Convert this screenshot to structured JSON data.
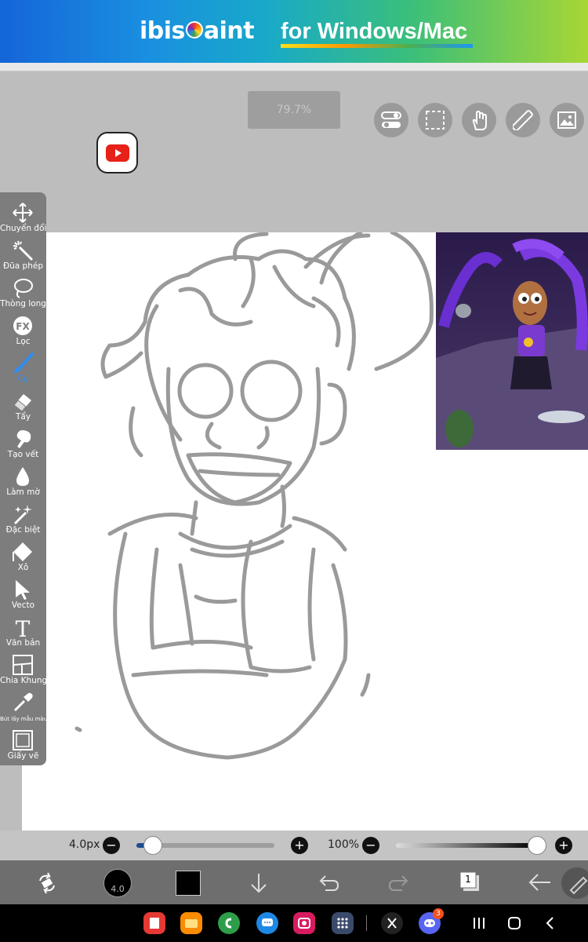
{
  "banner": {
    "brand_left": "ibis",
    "brand_right": "aint",
    "tagline": "for Windows/Mac"
  },
  "zoom_label": "79.7%",
  "top_buttons": [
    "toggle-icon",
    "selection-icon",
    "hand-icon",
    "ruler-icon",
    "image-icon"
  ],
  "toolbar": {
    "tools": [
      {
        "label": "Chuyển đổi",
        "icon": "move-icon"
      },
      {
        "label": "Đũa phép",
        "icon": "magic-wand-icon"
      },
      {
        "label": "Thòng long",
        "icon": "lasso-icon"
      },
      {
        "label": "Lọc",
        "icon": "fx-icon"
      },
      {
        "label": "Cọ",
        "icon": "brush-icon",
        "active": true
      },
      {
        "label": "Tẩy",
        "icon": "eraser-icon"
      },
      {
        "label": "Tạo vết",
        "icon": "smudge-icon"
      },
      {
        "label": "Làm mờ",
        "icon": "blur-icon"
      },
      {
        "label": "Đặc biệt",
        "icon": "special-icon"
      },
      {
        "label": "Xô",
        "icon": "bucket-icon"
      },
      {
        "label": "Vecto",
        "icon": "vector-icon"
      },
      {
        "label": "Văn bản",
        "icon": "text-icon"
      },
      {
        "label": "Chia Khung",
        "icon": "frame-divider-icon"
      },
      {
        "label": "Bút lấy mẫu màu",
        "icon": "eyedropper-icon"
      },
      {
        "label": "Giấy vẽ",
        "icon": "canvas-icon"
      }
    ],
    "fx_text": "FX",
    "text_glyph": "T",
    "active_color": "#2f8cf0"
  },
  "sliders": {
    "size_label": "4.0px",
    "size_fraction": 0.12,
    "opacity_label": "100%",
    "opacity_fraction": 1.0,
    "minus": "−",
    "plus": "+"
  },
  "bottom": {
    "brush_size": "4.0",
    "color": "#000000",
    "layer_count": "1"
  },
  "nav": {
    "discord_badge": "3"
  },
  "colors": {
    "banner_start": "#1565d8",
    "banner_end": "#a8d633",
    "toolbar": "#7d7d7d",
    "sketch": "#9a9a9a"
  }
}
